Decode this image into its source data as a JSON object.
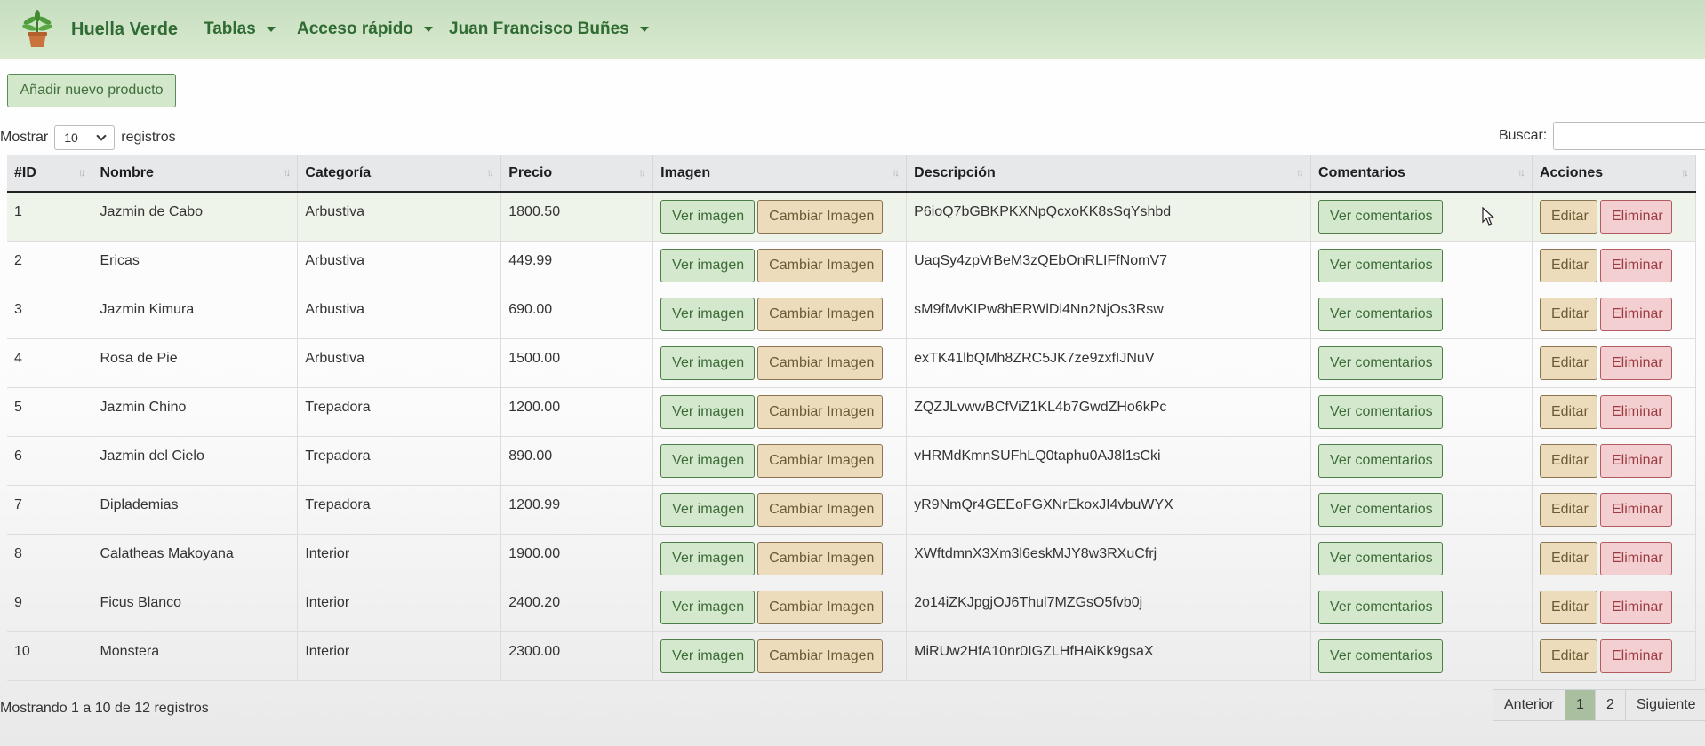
{
  "nav": {
    "brand": "Huella Verde",
    "items": [
      "Tablas",
      "Acceso rápido",
      "Juan Francisco Buñes"
    ]
  },
  "toolbar": {
    "add_label": "Añadir nuevo producto"
  },
  "length": {
    "prefix": "Mostrar",
    "value": "10",
    "suffix": "registros"
  },
  "search": {
    "label": "Buscar:",
    "value": ""
  },
  "table": {
    "headers": [
      "#ID",
      "Nombre",
      "Categoría",
      "Precio",
      "Imagen",
      "Descripción",
      "Comentarios",
      "Acciones"
    ],
    "buttons": {
      "ver_imagen": "Ver imagen",
      "cambiar_imagen": "Cambiar Imagen",
      "ver_comentarios": "Ver comentarios",
      "editar": "Editar",
      "eliminar": "Eliminar"
    },
    "rows": [
      {
        "id": "1",
        "nombre": "Jazmin de Cabo",
        "categoria": "Arbustiva",
        "precio": "1800.50",
        "descripcion": "P6ioQ7bGBKPKXNpQcxoKK8sSqYshbd"
      },
      {
        "id": "2",
        "nombre": "Ericas",
        "categoria": "Arbustiva",
        "precio": "449.99",
        "descripcion": "UaqSy4zpVrBeM3zQEbOnRLIFfNomV7"
      },
      {
        "id": "3",
        "nombre": "Jazmin Kimura",
        "categoria": "Arbustiva",
        "precio": "690.00",
        "descripcion": "sM9fMvKIPw8hERWlDl4Nn2NjOs3Rsw"
      },
      {
        "id": "4",
        "nombre": "Rosa de Pie",
        "categoria": "Arbustiva",
        "precio": "1500.00",
        "descripcion": "exTK41lbQMh8ZRC5JK7ze9zxfIJNuV"
      },
      {
        "id": "5",
        "nombre": "Jazmin Chino",
        "categoria": "Trepadora",
        "precio": "1200.00",
        "descripcion": "ZQZJLvwwBCfViZ1KL4b7GwdZHo6kPc"
      },
      {
        "id": "6",
        "nombre": "Jazmin del Cielo",
        "categoria": "Trepadora",
        "precio": "890.00",
        "descripcion": "vHRMdKmnSUFhLQ0taphu0AJ8l1sCki"
      },
      {
        "id": "7",
        "nombre": "Diplademias",
        "categoria": "Trepadora",
        "precio": "1200.99",
        "descripcion": "yR9NmQr4GEEoFGXNrEkoxJI4vbuWYX"
      },
      {
        "id": "8",
        "nombre": "Calatheas Makoyana",
        "categoria": "Interior",
        "precio": "1900.00",
        "descripcion": "XWftdmnX3Xm3l6eskMJY8w3RXuCfrj"
      },
      {
        "id": "9",
        "nombre": "Ficus Blanco",
        "categoria": "Interior",
        "precio": "2400.20",
        "descripcion": "2o14iZKJpgjOJ6Thul7MZGsO5fvb0j"
      },
      {
        "id": "10",
        "nombre": "Monstera",
        "categoria": "Interior",
        "precio": "2300.00",
        "descripcion": "MiRUw2HfA10nr0IGZLHfHAiKk9gsaX"
      }
    ]
  },
  "footer": {
    "info": "Mostrando 1 a 10 de 12 registros",
    "pagination": [
      "Anterior",
      "1",
      "2",
      "Siguiente"
    ],
    "active_page": "1"
  },
  "colors": {
    "navbar": "#c7dec0",
    "brand_text": "#2f6b33",
    "btn_green": "#d3e8cc",
    "btn_tan": "#ecdcbc",
    "btn_red": "#f4cfd1"
  }
}
